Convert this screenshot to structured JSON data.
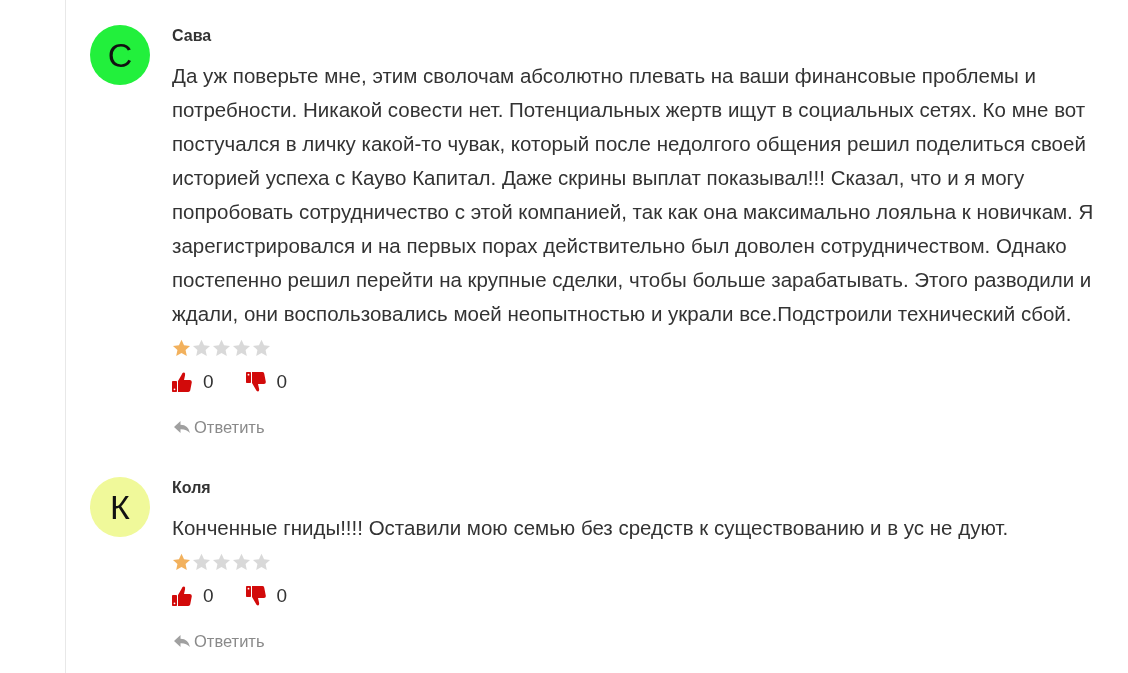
{
  "comments": [
    {
      "author": "Сава",
      "initial": "С",
      "color": "#22f03c",
      "text": "Да уж поверьте мне, этим сволочам абсолютно плевать на ваши финансовые проблемы и потребности. Никакой совести нет. Потенциальных жертв ищут в социальных сетях. Ко мне вот постучался в личку какой-то чувак, который после недолгого общения решил поделиться своей историей успеха с Кауво Капитал. Даже скрины выплат показывал!!! Сказал, что и я могу попробовать сотрудничество с этой компанией, так как она максимально лояльна к новичкам. Я зарегистрировался и на первых порах действительно был доволен сотрудничеством. Однако постепенно решил перейти на крупные сделки, чтобы больше зарабатывать. Этого разводили и ждали, они воспользовались моей неопытностью и украли все.Подстроили технический сбой.",
      "stars": 1,
      "likes": "0",
      "dislikes": "0",
      "reply": "Ответить"
    },
    {
      "author": "Коля",
      "initial": "К",
      "color": "#f0f99a",
      "text": "Конченные гниды!!!! Оставили мою семью без средств к существованию и в ус не дуют.",
      "stars": 1,
      "likes": "0",
      "dislikes": "0",
      "reply": "Ответить"
    }
  ]
}
